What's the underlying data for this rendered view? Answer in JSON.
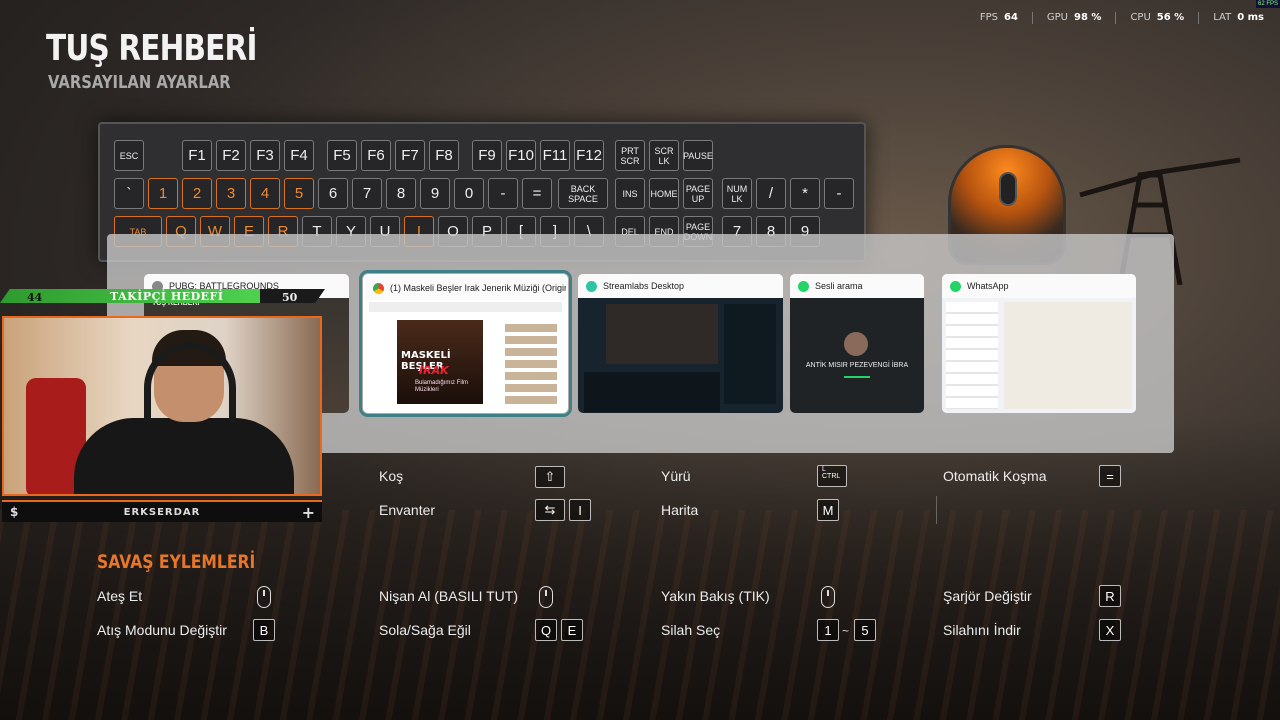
{
  "hud": {
    "fps_label": "FPS",
    "fps_value": "64",
    "gpu_label": "GPU",
    "gpu_value": "98 %",
    "cpu_label": "CPU",
    "cpu_value": "56 %",
    "lat_label": "LAT",
    "lat_value": "0 ms",
    "tiny_fps": "62 FPS"
  },
  "page": {
    "title": "TUŞ REHBERİ",
    "subtitle": "VARSAYILAN AYARLAR"
  },
  "keyboard": {
    "rows": [
      [
        "ESC",
        "F1",
        "F2",
        "F3",
        "F4",
        "F5",
        "F6",
        "F7",
        "F8",
        "F9",
        "F10",
        "F11",
        "F12",
        "PRT SCR",
        "SCR LK",
        "PAUSE"
      ],
      [
        "`",
        "1",
        "2",
        "3",
        "4",
        "5",
        "6",
        "7",
        "8",
        "9",
        "0",
        "-",
        "=",
        "BACK SPACE",
        "INS",
        "HOME",
        "PAGE UP",
        "NUM LK",
        "/",
        "*",
        "-"
      ],
      [
        "TAB",
        "Q",
        "W",
        "E",
        "R",
        "T",
        "Y",
        "U",
        "I",
        "O",
        "P",
        "[",
        "]",
        "\\",
        "DEL",
        "END",
        "PAGE DOWN",
        "7",
        "8",
        "9"
      ]
    ]
  },
  "switcher": {
    "windows": [
      {
        "title": "PUBG: BATTLEGROUNDS",
        "inner_label": "TUŞ REHBERİ",
        "icon_color": "#888888",
        "active": false
      },
      {
        "title": "(1) Maskeli Beşler Irak Jenerik Müziği (Origin...",
        "poster_title": "MASKELİ BEŞLER",
        "poster_sub": "IRAK",
        "poster_tag": "Bulamadığımız Film Müzikleri",
        "icon_color": "#ea4335",
        "active": true
      },
      {
        "title": "Streamlabs Desktop",
        "icon_color": "#31c3a2",
        "active": false
      },
      {
        "title": "Sesli arama",
        "caller": "ANTİK MISIR PEZEVENGİ İBRA",
        "icon_color": "#25d366",
        "active": false
      },
      {
        "title": "WhatsApp",
        "icon_color": "#25d366",
        "active": false
      }
    ]
  },
  "webcam": {
    "follow_label": "TAKİPÇİ HEDEFİ",
    "follow_current": "44",
    "follow_goal": "50",
    "streamer_name": "ERKSERDAR",
    "left_symbol": "$",
    "right_symbol": "+"
  },
  "movement": {
    "run": {
      "label": "Koş",
      "key": "⇧"
    },
    "walk": {
      "label": "Yürü",
      "key": "L CTRL"
    },
    "auto_run": {
      "label": "Otomatik Koşma",
      "key": "="
    },
    "inventory": {
      "label": "Envanter",
      "key1": "⇆",
      "key2": "I"
    },
    "map": {
      "label": "Harita",
      "key": "M"
    }
  },
  "combat": {
    "section_title": "SAVAŞ EYLEMLERİ",
    "fire": {
      "label": "Ateş Et"
    },
    "aim": {
      "label": "Nişan Al (BASILI TUT)"
    },
    "close_look": {
      "label": "Yakın Bakış (TIK)"
    },
    "reload": {
      "label": "Şarjör Değiştir",
      "key": "R"
    },
    "fire_mode": {
      "label": "Atış Modunu Değiştir",
      "key": "B"
    },
    "lean": {
      "label": "Sola/Sağa Eğil",
      "key1": "Q",
      "key2": "E"
    },
    "weapon_select": {
      "label": "Silah Seç",
      "key1": "1",
      "sep": "~",
      "key2": "5"
    },
    "holster": {
      "label": "Silahını İndir",
      "key": "X"
    }
  },
  "colors": {
    "accent_orange": "#e8762a",
    "switcher_active": "#3f7f86",
    "follow_green": "#4fd14f"
  }
}
